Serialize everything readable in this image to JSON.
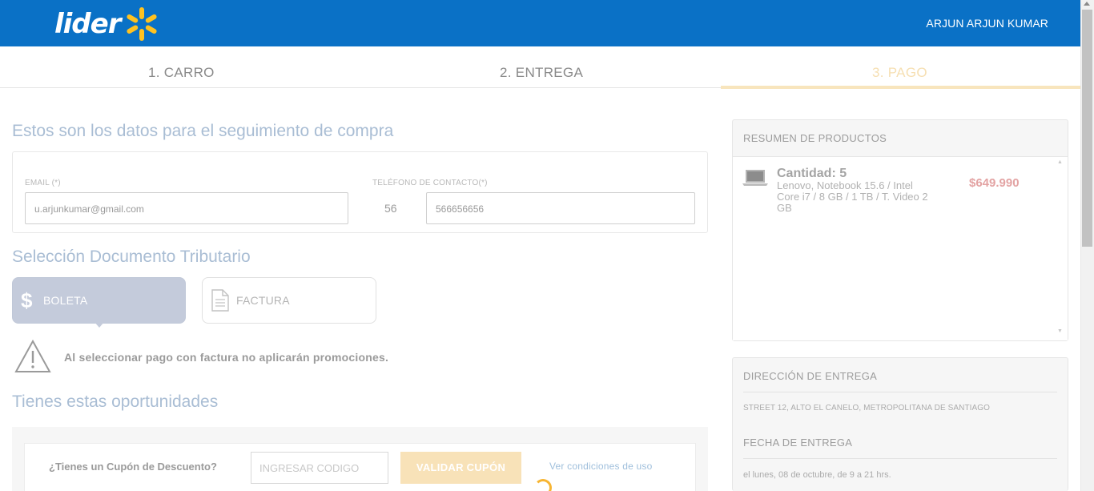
{
  "header": {
    "logo_text": "lider",
    "user_name": "ARJUN  ARJUN KUMAR",
    "brand_color": "#0a71c6",
    "spark_color": "#ffc220"
  },
  "steps": [
    {
      "label": "1. CARRO"
    },
    {
      "label": "2. ENTREGA"
    },
    {
      "label": "3. PAGO",
      "active": true
    }
  ],
  "tracking": {
    "title": "Estos son los datos para el seguimiento de compra",
    "email_label": "EMAIL (*)",
    "email_value": "u.arjunkumar@gmail.com",
    "phone_label": "TELÉFONO DE CONTACTO(*)",
    "phone_prefix": "56",
    "phone_value": "566656656"
  },
  "tax_document": {
    "title": "Selección Documento Tributario",
    "boleta_icon": "$",
    "boleta_label": "BOLETA",
    "factura_label": "FACTURA",
    "warning_icon": "warning-icon",
    "warning_text": "Al seleccionar pago con factura no aplicarán promociones."
  },
  "opportunities": {
    "title": "Tienes estas oportunidades",
    "coupon_question": "¿Tienes un Cupón de Descuento?",
    "coupon_placeholder": "INGRESAR CODIGO",
    "validate_button": "VALIDAR CUPÓN",
    "conditions_link": "Ver condiciones de uso"
  },
  "summary": {
    "title": "RESUMEN DE PRODUCTOS",
    "product_qty": "Cantidad: 5",
    "product_desc": "Lenovo, Notebook 15.6 / Intel Core i7 / 8 GB / 1 TB / T. Video 2 GB",
    "product_price": "$649.990",
    "scroll_up": "▲",
    "scroll_down": "▼"
  },
  "delivery": {
    "address_title": "DIRECCIÓN DE ENTREGA",
    "address": "STREET 12, ALTO EL CANELO, METROPOLITANA DE SANTIAGO",
    "date_title": "FECHA DE ENTREGA",
    "date": "el lunes, 08 de octubre, de 9 a 21 hrs."
  }
}
